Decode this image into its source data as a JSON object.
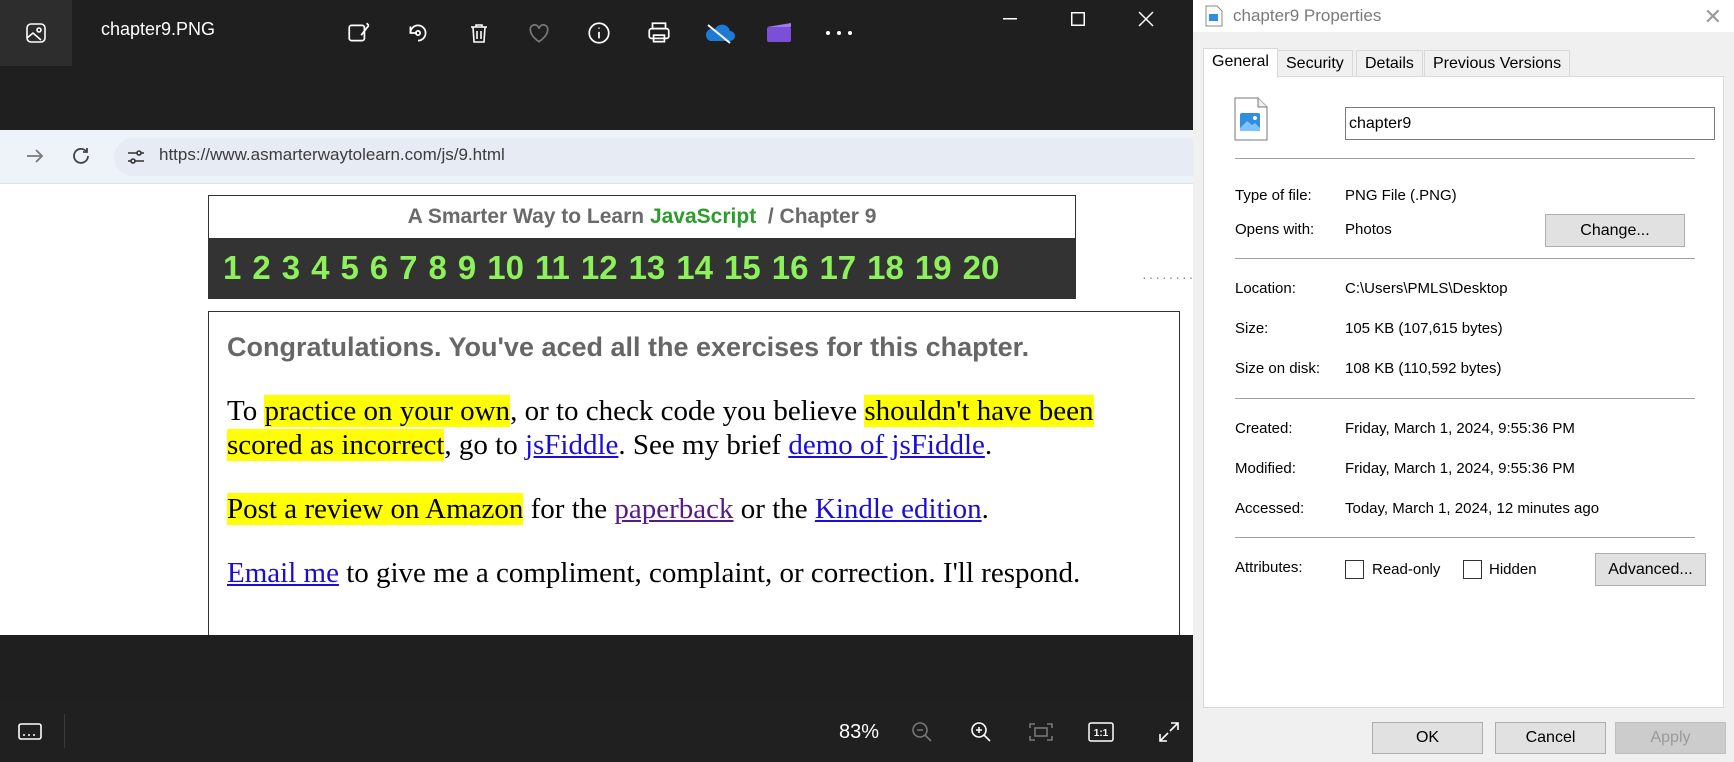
{
  "viewer": {
    "file_name": "chapter9.PNG",
    "zoom": "83%",
    "url": "https://www.asmarterwaytolearn.com/js/9.html",
    "page": {
      "header_prefix": "A Smarter Way to Learn",
      "header_js": "JavaScript",
      "header_suffix": "/  Chapter 9",
      "chapters": [
        "1",
        "2",
        "3",
        "4",
        "5",
        "6",
        "7",
        "8",
        "9",
        "10",
        "11",
        "12",
        "13",
        "14",
        "15",
        "16",
        "17",
        "18",
        "19",
        "20"
      ],
      "congrats": "Congratulations. You've aced all the exercises for this chapter.",
      "p1_a": "To ",
      "p1_hl1": "practice on your own",
      "p1_b": ", or to check code you believe ",
      "p1_hl2": "shouldn't have been scored as incorrect",
      "p1_c": ", go to ",
      "p1_link1": "jsFiddle",
      "p1_d": ". See my brief ",
      "p1_link2": "demo of jsFiddle",
      "p1_e": ".",
      "p2_hl": "Post a review on Amazon",
      "p2_a": " for the ",
      "p2_link1": "paperback",
      "p2_b": " or the ",
      "p2_link2": "Kindle edition",
      "p2_c": ".",
      "p3_link": "Email me",
      "p3_a": " to give me a compliment, complaint, or correction. I'll respond."
    },
    "icons": [
      "photo-app-icon",
      "edit-image-icon",
      "rotate-icon",
      "delete-icon",
      "favorite-icon",
      "info-icon",
      "print-icon",
      "onedrive-icon",
      "clipchamp-icon",
      "more-icon",
      "minimize-icon",
      "maximize-icon",
      "close-icon",
      "forward-icon",
      "refresh-icon",
      "site-settings-icon",
      "filmstrip-icon",
      "zoom-out-icon",
      "zoom-in-icon",
      "fit-icon",
      "actual-size-icon",
      "fullscreen-icon"
    ]
  },
  "properties": {
    "title": "chapter9 Properties",
    "tabs": [
      "General",
      "Security",
      "Details",
      "Previous Versions"
    ],
    "active_tab": "General",
    "name": "chapter9",
    "type_label": "Type of file:",
    "type_value": "PNG File (.PNG)",
    "opens_label": "Opens with:",
    "opens_value": "Photos",
    "change_button": "Change...",
    "location_label": "Location:",
    "location_value": "C:\\Users\\PMLS\\Desktop",
    "size_label": "Size:",
    "size_value": "105 KB (107,615 bytes)",
    "disk_label": "Size on disk:",
    "disk_value": "108 KB (110,592 bytes)",
    "created_label": "Created:",
    "created_value": "Friday, March 1, 2024, 9:55:36 PM",
    "modified_label": "Modified:",
    "modified_value": "Friday, March 1, 2024, 9:55:36 PM",
    "accessed_label": "Accessed:",
    "accessed_value": "Today, March 1, 2024, 12 minutes ago",
    "attributes_label": "Attributes:",
    "readonly_label": "Read-only",
    "hidden_label": "Hidden",
    "advanced_button": "Advanced...",
    "ok_button": "OK",
    "cancel_button": "Cancel",
    "apply_button": "Apply"
  }
}
